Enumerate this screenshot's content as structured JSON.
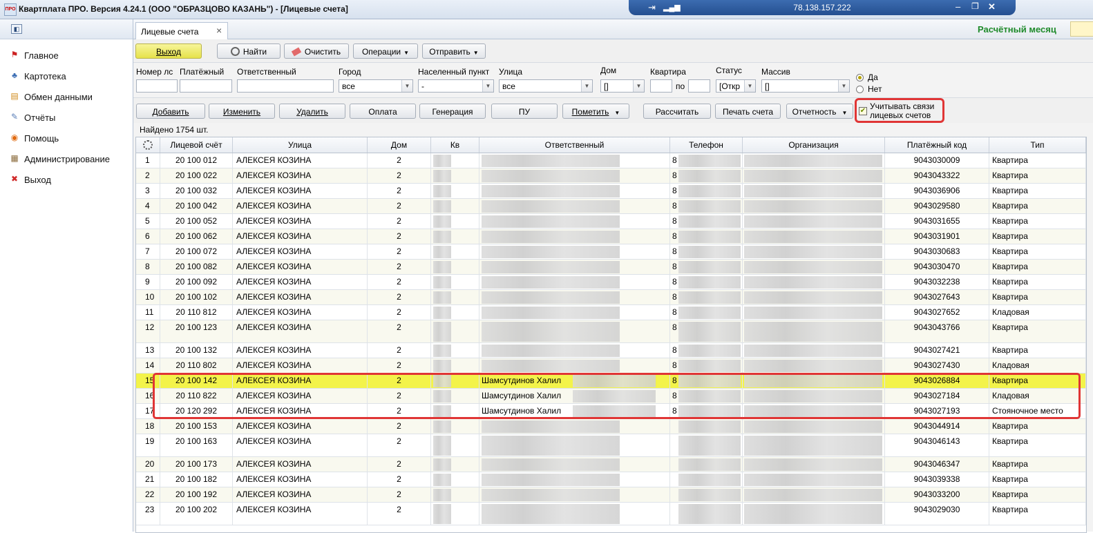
{
  "window": {
    "title": "Квартплата ПРО.  Версия 4.24.1 (ООО \"ОБРАЗЦОВО КАЗАНЬ\") - [Лицевые счета]",
    "app_icon_text": "ПРО",
    "remote_ip": "78.138.157.222"
  },
  "sidebar": {
    "items": [
      {
        "label": "Главное",
        "icon": "flag-icon",
        "color": "#cc2222"
      },
      {
        "label": "Картотека",
        "icon": "people-icon",
        "color": "#3b6db3"
      },
      {
        "label": "Обмен данными",
        "icon": "books-icon",
        "color": "#d08a1a"
      },
      {
        "label": "Отчёты",
        "icon": "report-icon",
        "color": "#5a7fb8"
      },
      {
        "label": "Помощь",
        "icon": "help-icon",
        "color": "#e06a10"
      },
      {
        "label": "Администрирование",
        "icon": "admin-icon",
        "color": "#8a6a3a"
      },
      {
        "label": "Выход",
        "icon": "exit-icon",
        "color": "#d02a2a"
      }
    ]
  },
  "tabs": [
    {
      "label": "Лицевые счета",
      "close": "×"
    }
  ],
  "period_label": "Расчётный месяц",
  "toolbar": {
    "exit": "Выход",
    "find": "Найти",
    "clear": "Очистить",
    "operations": "Операции",
    "send": "Отправить"
  },
  "filters": {
    "account_no": {
      "label": "Номер лс",
      "value": ""
    },
    "payment": {
      "label": "Платёжный",
      "value": ""
    },
    "responsible": {
      "label": "Ответственный",
      "value": ""
    },
    "city": {
      "label": "Город",
      "value": "все"
    },
    "locality": {
      "label": "Населенный пункт",
      "value": "-"
    },
    "street": {
      "label": "Улица",
      "value": "все"
    },
    "house": {
      "label": "Дом",
      "value": "[]"
    },
    "apartment": {
      "label": "Квартира",
      "from": "",
      "to_label": "по",
      "to": ""
    },
    "status": {
      "label": "Статус",
      "value": "[Откр"
    },
    "massiv": {
      "label": "Массив",
      "value": "[]"
    },
    "radio_yes": "Да",
    "radio_no": "Нет",
    "radio_selected": "Да"
  },
  "actions": {
    "add": "Добавить",
    "edit": "Изменить",
    "delete": "Удалить",
    "payment": "Оплата",
    "generate": "Генерация",
    "pu": "ПУ",
    "mark": "Пометить",
    "calculate": "Рассчитать",
    "print": "Печать счета",
    "reporting": "Отчетность",
    "link_checkbox": "Учитывать связи лицевых счетов",
    "link_checked": true
  },
  "found_text": "Найдено 1754 шт.",
  "grid": {
    "columns": [
      "",
      "Лицевой счёт",
      "Улица",
      "Дом",
      "Кв",
      "Ответственный",
      "Телефон",
      "Организация",
      "Платёжный код",
      "Тип"
    ],
    "rows": [
      {
        "n": "1",
        "acc": "20 100 012",
        "street": "АЛЕКСЕЯ КОЗИНА",
        "dom": "2",
        "kv": "",
        "resp": "",
        "tel": "8",
        "pay": "9043030009",
        "type": "Квартира"
      },
      {
        "n": "2",
        "acc": "20 100 022",
        "street": "АЛЕКСЕЯ КОЗИНА",
        "dom": "2",
        "kv": "",
        "resp": "",
        "tel": "8",
        "pay": "9043043322",
        "type": "Квартира"
      },
      {
        "n": "3",
        "acc": "20 100 032",
        "street": "АЛЕКСЕЯ КОЗИНА",
        "dom": "2",
        "kv": "",
        "resp": "",
        "tel": "8",
        "pay": "9043036906",
        "type": "Квартира"
      },
      {
        "n": "4",
        "acc": "20 100 042",
        "street": "АЛЕКСЕЯ КОЗИНА",
        "dom": "2",
        "kv": "",
        "resp": "",
        "tel": "8",
        "pay": "9043029580",
        "type": "Квартира"
      },
      {
        "n": "5",
        "acc": "20 100 052",
        "street": "АЛЕКСЕЯ КОЗИНА",
        "dom": "2",
        "kv": "",
        "resp": "",
        "tel": "8",
        "pay": "9043031655",
        "type": "Квартира"
      },
      {
        "n": "6",
        "acc": "20 100 062",
        "street": "АЛЕКСЕЯ КОЗИНА",
        "dom": "2",
        "kv": "",
        "resp": "",
        "tel": "8",
        "pay": "9043031901",
        "type": "Квартира"
      },
      {
        "n": "7",
        "acc": "20 100 072",
        "street": "АЛЕКСЕЯ КОЗИНА",
        "dom": "2",
        "kv": "",
        "resp": "",
        "tel": "8",
        "pay": "9043030683",
        "type": "Квартира"
      },
      {
        "n": "8",
        "acc": "20 100 082",
        "street": "АЛЕКСЕЯ КОЗИНА",
        "dom": "2",
        "kv": "",
        "resp": "",
        "tel": "8",
        "pay": "9043030470",
        "type": "Квартира"
      },
      {
        "n": "9",
        "acc": "20 100 092",
        "street": "АЛЕКСЕЯ КОЗИНА",
        "dom": "2",
        "kv": "",
        "resp": "",
        "tel": "8",
        "pay": "9043032238",
        "type": "Квартира"
      },
      {
        "n": "10",
        "acc": "20 100 102",
        "street": "АЛЕКСЕЯ КОЗИНА",
        "dom": "2",
        "kv": "",
        "resp": "",
        "tel": "8",
        "pay": "9043027643",
        "type": "Квартира"
      },
      {
        "n": "11",
        "acc": "20 110 812",
        "street": "АЛЕКСЕЯ КОЗИНА",
        "dom": "2",
        "kv": "",
        "resp": "",
        "tel": "8",
        "pay": "9043027652",
        "type": "Кладовая"
      },
      {
        "n": "12",
        "acc": "20 100 123",
        "street": "АЛЕКСЕЯ КОЗИНА",
        "dom": "2",
        "kv": "",
        "resp": "",
        "tel": "8",
        "pay": "9043043766",
        "type": "Квартира",
        "tall": true
      },
      {
        "n": "13",
        "acc": "20 100 132",
        "street": "АЛЕКСЕЯ КОЗИНА",
        "dom": "2",
        "kv": "",
        "resp": "",
        "tel": "8",
        "pay": "9043027421",
        "type": "Квартира"
      },
      {
        "n": "14",
        "acc": "20 110 802",
        "street": "АЛЕКСЕЯ КОЗИНА",
        "dom": "2",
        "kv": "",
        "resp": "",
        "tel": "8",
        "pay": "9043027430",
        "type": "Кладовая"
      },
      {
        "n": "15",
        "acc": "20 100 142",
        "street": "АЛЕКСЕЯ КОЗИНА",
        "dom": "2",
        "kv": "",
        "resp": "Шамсутдинов Халил",
        "tel": "8",
        "pay": "9043026884",
        "type": "Квартира",
        "selected": true
      },
      {
        "n": "16",
        "acc": "20 110 822",
        "street": "АЛЕКСЕЯ КОЗИНА",
        "dom": "2",
        "kv": "",
        "resp": "Шамсутдинов Халил",
        "tel": "8",
        "pay": "9043027184",
        "type": "Кладовая"
      },
      {
        "n": "17",
        "acc": "20 120 292",
        "street": "АЛЕКСЕЯ КОЗИНА",
        "dom": "2",
        "kv": "",
        "resp": "Шамсутдинов Халил",
        "tel": "8",
        "pay": "9043027193",
        "type": "Стояночное место"
      },
      {
        "n": "18",
        "acc": "20 100 153",
        "street": "АЛЕКСЕЯ КОЗИНА",
        "dom": "2",
        "kv": "",
        "resp": "",
        "tel": "",
        "pay": "9043044914",
        "type": "Квартира"
      },
      {
        "n": "19",
        "acc": "20 100 163",
        "street": "АЛЕКСЕЯ КОЗИНА",
        "dom": "2",
        "kv": "",
        "resp": "",
        "tel": "",
        "pay": "9043046143",
        "type": "Квартира",
        "tall": true
      },
      {
        "n": "20",
        "acc": "20 100 173",
        "street": "АЛЕКСЕЯ КОЗИНА",
        "dom": "2",
        "kv": "",
        "resp": "",
        "tel": "",
        "pay": "9043046347",
        "type": "Квартира"
      },
      {
        "n": "21",
        "acc": "20 100 182",
        "street": "АЛЕКСЕЯ КОЗИНА",
        "dom": "2",
        "kv": "",
        "resp": "",
        "tel": "",
        "pay": "9043039338",
        "type": "Квартира"
      },
      {
        "n": "22",
        "acc": "20 100 192",
        "street": "АЛЕКСЕЯ КОЗИНА",
        "dom": "2",
        "kv": "",
        "resp": "",
        "tel": "",
        "pay": "9043033200",
        "type": "Квартира"
      },
      {
        "n": "23",
        "acc": "20 100 202",
        "street": "АЛЕКСЕЯ КОЗИНА",
        "dom": "2",
        "kv": "",
        "resp": "",
        "tel": "",
        "pay": "9043029030",
        "type": "Квартира",
        "tall": true
      }
    ]
  },
  "colors": {
    "selected_row": "#f3f34a",
    "highlight_border": "#e03535",
    "period_text": "#1e8a2a"
  }
}
